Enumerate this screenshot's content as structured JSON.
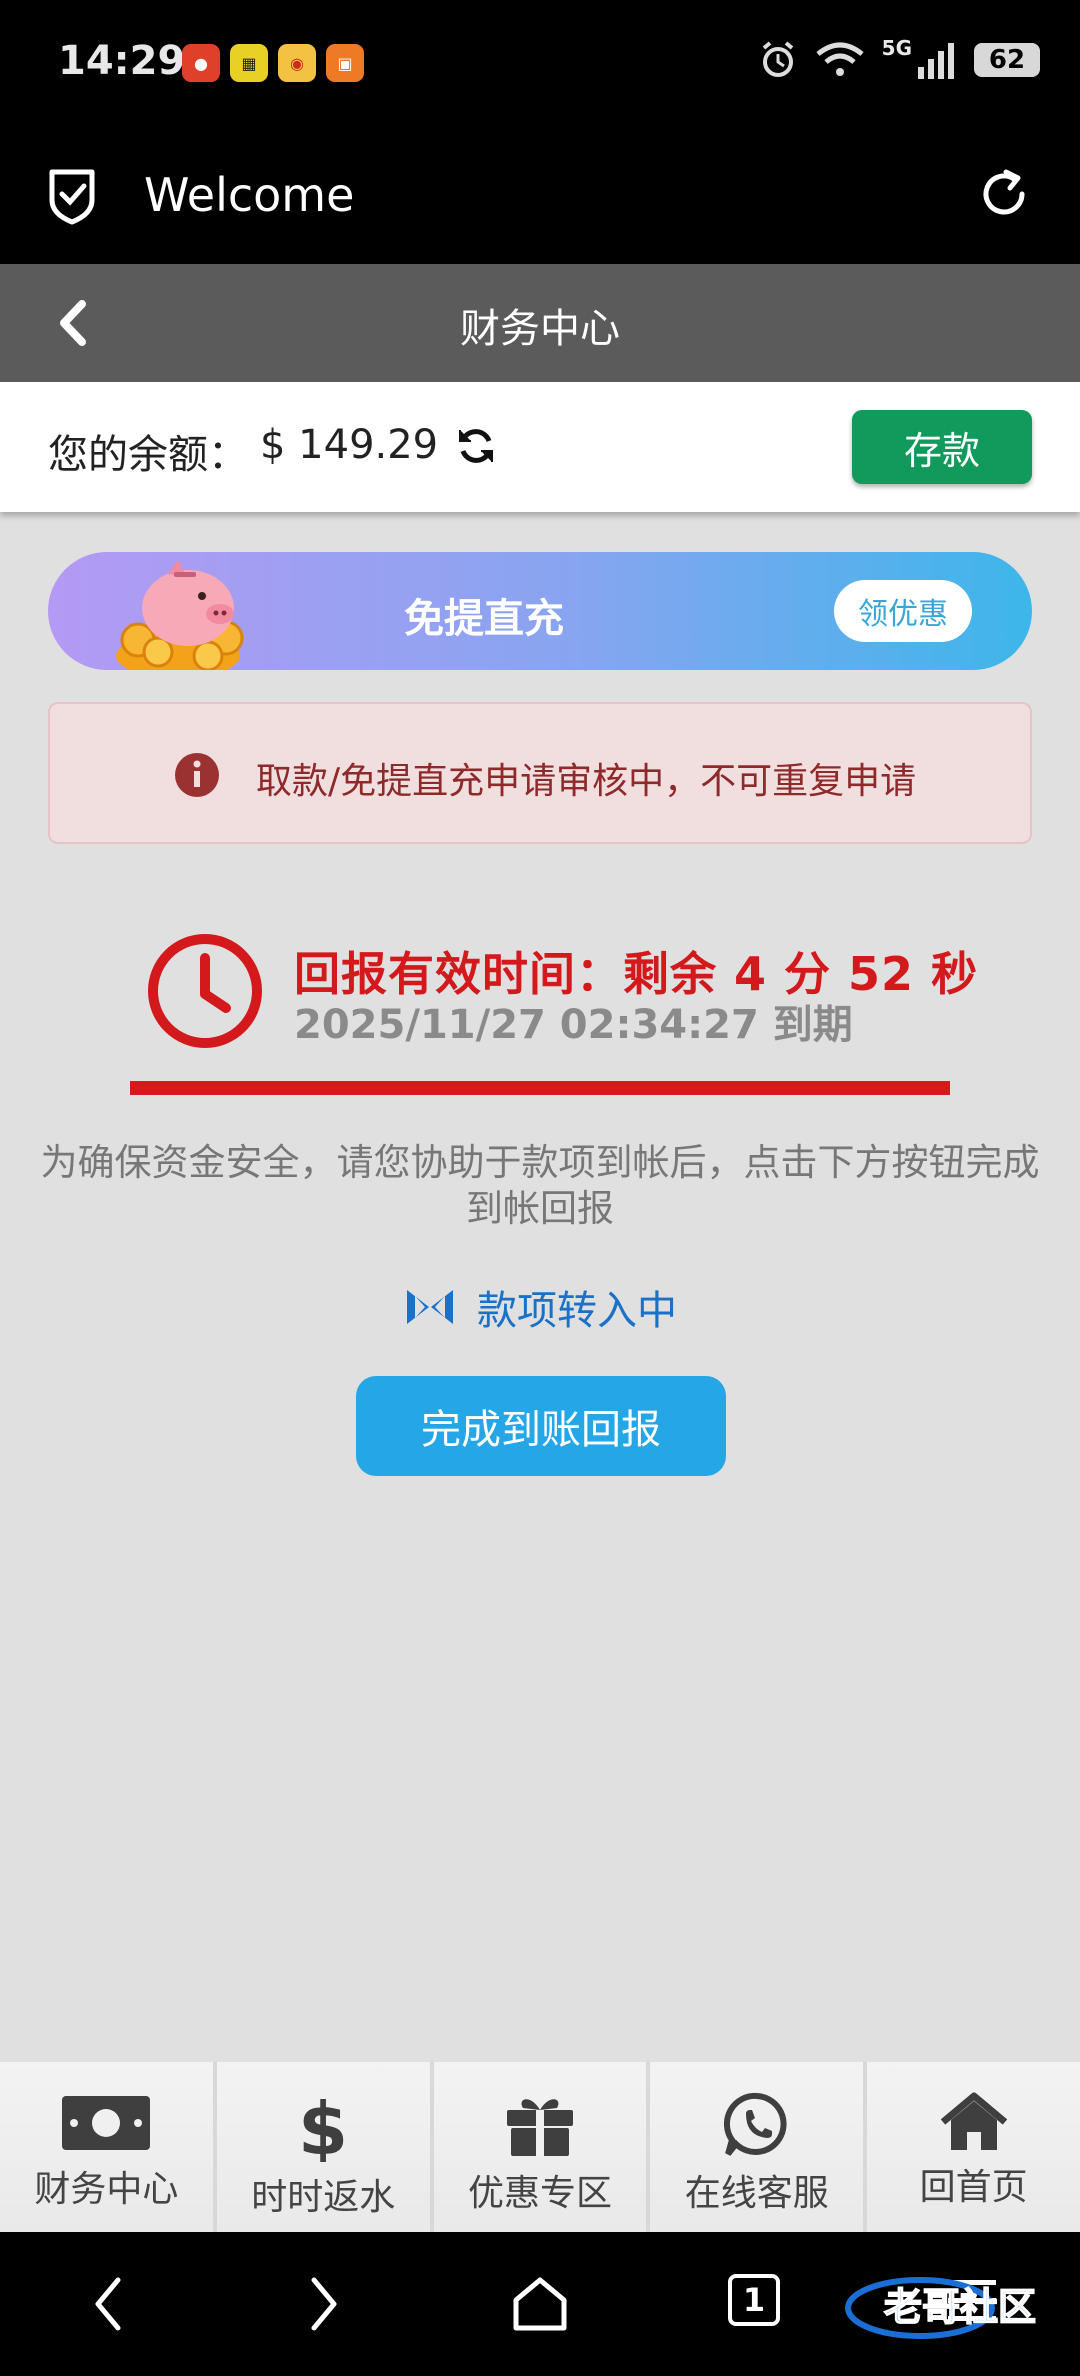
{
  "status_bar": {
    "time": "14:29",
    "network": "5G",
    "battery": "62",
    "notif_icons": [
      "app-icon-red",
      "app-icon-yellow",
      "weibo-icon",
      "app-icon-orange"
    ]
  },
  "browser": {
    "title": "Welcome"
  },
  "header": {
    "title": "财务中心"
  },
  "balance": {
    "label": "您的余额：",
    "value": "$ 149.29",
    "deposit_label": "存款"
  },
  "promo": {
    "title": "免提直充",
    "button_label": "领优惠"
  },
  "alert": {
    "text": "取款/免提直充申请审核中，不可重复申请"
  },
  "timer": {
    "title": "回报有效时间：剩余 4 分 52 秒",
    "expiry": "2025/11/27 02:34:27 到期"
  },
  "info": {
    "text": "为确保资金安全，请您协助于款项到帐后，点击下方按钮完成到帐回报"
  },
  "transfer": {
    "status": "款项转入中"
  },
  "confirm_button": {
    "label": "完成到账回报"
  },
  "bottom_nav": {
    "items": [
      {
        "label": "财务中心",
        "icon": "money-bill-icon"
      },
      {
        "label": "时时返水",
        "icon": "dollar-icon"
      },
      {
        "label": "优惠专区",
        "icon": "gift-icon"
      },
      {
        "label": "在线客服",
        "icon": "whatsapp-icon"
      },
      {
        "label": "回首页",
        "icon": "home-icon"
      }
    ]
  },
  "system_nav": {
    "tab_count": "1",
    "watermark": "老哥社区"
  },
  "colors": {
    "deposit_green": "#129a5c",
    "timer_red": "#d4191c",
    "confirm_blue": "#25a6e6",
    "transfer_blue": "#1a71c8"
  }
}
